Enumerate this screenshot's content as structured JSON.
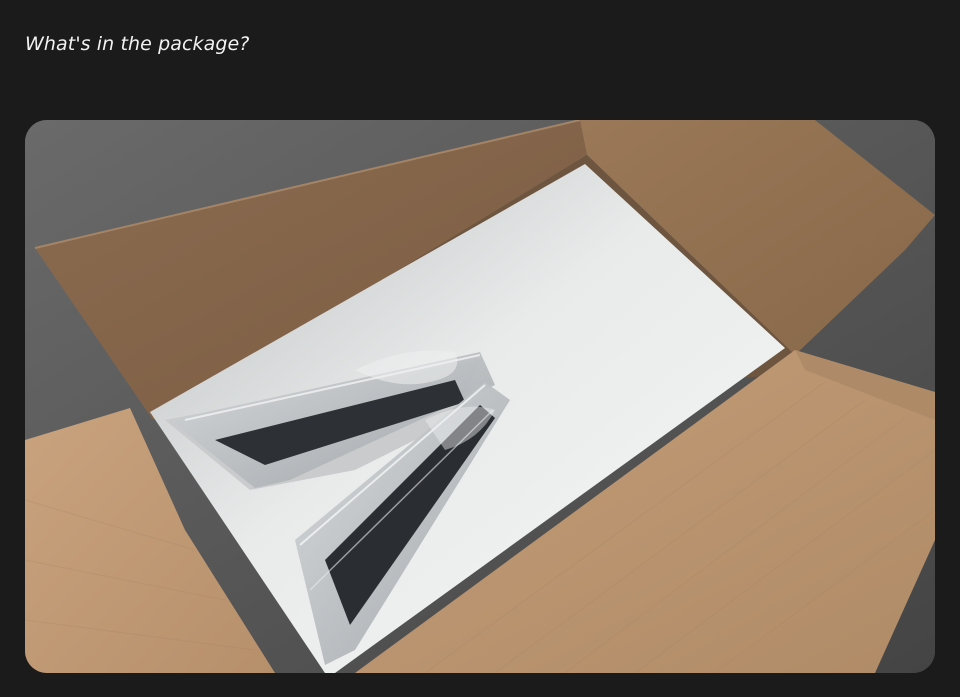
{
  "heading": "What's in the package?",
  "photo": {
    "subject": "open-cardboard-box-with-foam-insert",
    "colors": {
      "page_background": "#1b1b1b",
      "floor": "#5a5a5a",
      "cardboard": "#b48f6c",
      "cardboard_shadow": "#8d6d52",
      "foam": "#e4e6e6",
      "plastic_wrap": "#b9bcc0",
      "metal_part": "#2a2d31"
    }
  }
}
